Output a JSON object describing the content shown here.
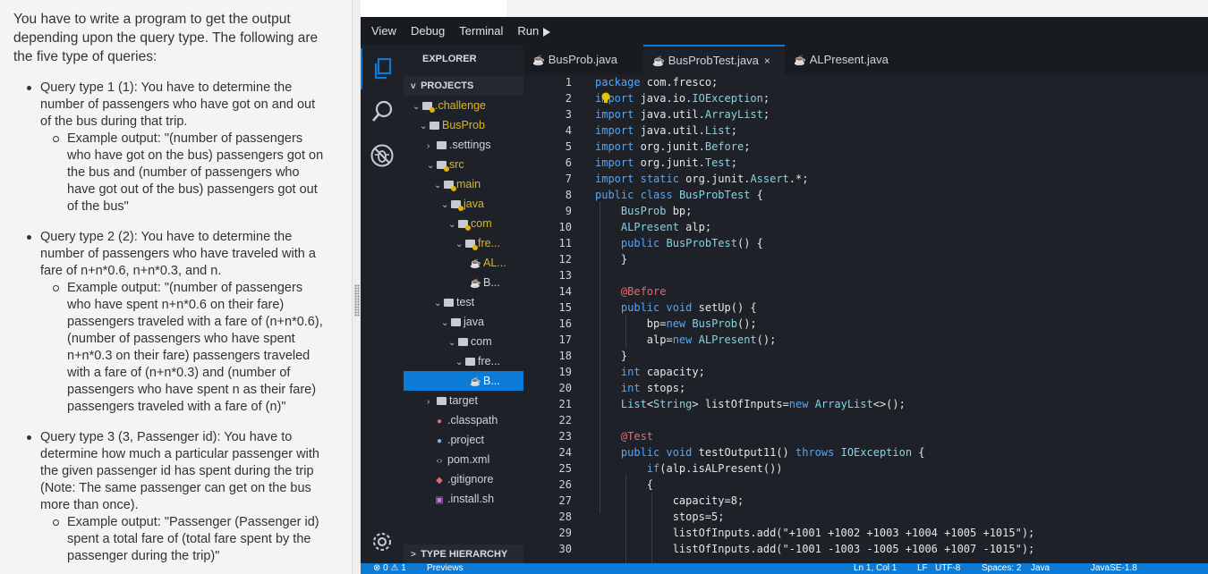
{
  "problem": {
    "intro": "You have to write a program to get the output depending upon the query type. The following are the five type of queries:",
    "queries": [
      {
        "text": "Query type 1 (1): You have to determine the number of passengers who have got on and out of the bus during that trip.",
        "example": "Example output: \"(number of passengers who have got on the bus) passengers got on the bus and (number of passengers who have got out of the bus) passengers got out of the bus\""
      },
      {
        "text": "Query type 2 (2): You have to determine the number of passengers who have traveled with a fare of n+n*0.6, n+n*0.3, and n.",
        "example": "Example output: \"(number of passengers who have spent n+n*0.6 on their fare) passengers traveled with a fare of (n+n*0.6), (number of passengers who have spent n+n*0.3 on their fare) passengers traveled with a fare of (n+n*0.3) and (number of passengers who have spent n as their fare) passengers traveled with a fare of (n)\""
      },
      {
        "text": "Query type 3 (3, Passenger id): You have to determine how much a particular passenger with the given passenger id has spent during the trip (Note: The same passenger can get on the bus more than once).",
        "example": "Example output: \"Passenger (Passenger id) spent a total fare of (total fare spent by the passenger during the trip)\""
      }
    ]
  },
  "menu": {
    "view": "View",
    "debug": "Debug",
    "terminal": "Terminal",
    "run": "Run"
  },
  "explorer": {
    "title": "EXPLORER",
    "projects": "PROJECTS",
    "type_hierarchy": "TYPE HIERARCHY",
    "tree": [
      {
        "label": ".challenge",
        "indent": 0,
        "chev": "v",
        "kind": "folder",
        "color": "yellow",
        "dot": true
      },
      {
        "label": "BusProb",
        "indent": 1,
        "chev": "v",
        "kind": "folder",
        "color": "yellow",
        "dot": false
      },
      {
        "label": ".settings",
        "indent": 2,
        "chev": ">",
        "kind": "folder",
        "color": "",
        "dot": false
      },
      {
        "label": "src",
        "indent": 2,
        "chev": "v",
        "kind": "folder",
        "color": "yellow",
        "dot": true
      },
      {
        "label": "main",
        "indent": 3,
        "chev": "v",
        "kind": "folder",
        "color": "yellow",
        "dot": true
      },
      {
        "label": "java",
        "indent": 4,
        "chev": "v",
        "kind": "folder",
        "color": "yellow",
        "dot": true
      },
      {
        "label": "com",
        "indent": 5,
        "chev": "v",
        "kind": "folder",
        "color": "yellow",
        "dot": true
      },
      {
        "label": "fre...",
        "indent": 6,
        "chev": "v",
        "kind": "folder",
        "color": "yellow",
        "dot": true
      },
      {
        "label": "AL...",
        "indent": 7,
        "chev": "",
        "kind": "java",
        "color": "yellow",
        "dot": true
      },
      {
        "label": "B...",
        "indent": 7,
        "chev": "",
        "kind": "java",
        "color": "",
        "dot": false
      },
      {
        "label": "test",
        "indent": 3,
        "chev": "v",
        "kind": "folder",
        "color": "",
        "dot": false
      },
      {
        "label": "java",
        "indent": 4,
        "chev": "v",
        "kind": "folder",
        "color": "",
        "dot": false
      },
      {
        "label": "com",
        "indent": 5,
        "chev": "v",
        "kind": "folder",
        "color": "",
        "dot": false
      },
      {
        "label": "fre...",
        "indent": 6,
        "chev": "v",
        "kind": "folder",
        "color": "",
        "dot": false
      },
      {
        "label": "B...",
        "indent": 7,
        "chev": "",
        "kind": "java",
        "color": "",
        "dot": false,
        "selected": true
      },
      {
        "label": "target",
        "indent": 2,
        "chev": ">",
        "kind": "folder",
        "color": "",
        "dot": false
      },
      {
        "label": ".classpath",
        "indent": 2,
        "chev": "",
        "kind": "classpath",
        "color": "",
        "dot": false
      },
      {
        "label": ".project",
        "indent": 2,
        "chev": "",
        "kind": "project",
        "color": "",
        "dot": false
      },
      {
        "label": "pom.xml",
        "indent": 2,
        "chev": "",
        "kind": "xml",
        "color": "",
        "dot": false
      },
      {
        "label": ".gitignore",
        "indent": 2,
        "chev": "",
        "kind": "git",
        "color": "",
        "dot": false
      },
      {
        "label": ".install.sh",
        "indent": 2,
        "chev": "",
        "kind": "sh",
        "color": "",
        "dot": false
      }
    ]
  },
  "tabs": [
    {
      "label": "BusProb.java",
      "active": false,
      "close": ""
    },
    {
      "label": "BusProbTest.java",
      "active": true,
      "close": "×"
    },
    {
      "label": "ALPresent.java",
      "active": false,
      "close": ""
    }
  ],
  "code": {
    "lines": [
      "package com.fresco;",
      "import java.io.IOException;",
      "import java.util.ArrayList;",
      "import java.util.List;",
      "import org.junit.Before;",
      "import org.junit.Test;",
      "import static org.junit.Assert.*;",
      "public class BusProbTest {",
      "    BusProb bp;",
      "    ALPresent alp;",
      "    public BusProbTest() {",
      "    }",
      "",
      "    @Before",
      "    public void setUp() {",
      "        bp=new BusProb();",
      "        alp=new ALPresent();",
      "    }",
      "    int capacity;",
      "    int stops;",
      "    List<String> listOfInputs=new ArrayList<>();",
      "",
      "    @Test",
      "    public void testOutput11() throws IOException {",
      "        if(alp.isALPresent())",
      "        {",
      "            capacity=8;",
      "            stops=5;",
      "            listOfInputs.add(\"+1001 +1002 +1003 +1004 +1005 +1015\");",
      "            listOfInputs.add(\"-1001 -1003 -1005 +1006 +1007 -1015\");"
    ]
  },
  "status": {
    "problems": "⊗ 0 ⚠ 1",
    "previews": "Previews",
    "position": "Ln 1, Col 1",
    "eol": "LF",
    "encoding": "UTF-8",
    "spaces": "Spaces: 2",
    "language": "Java",
    "jdk": "JavaSE-1.8"
  },
  "colors": {
    "accent": "#0c7bd6",
    "editor_bg": "#1e2127",
    "keyword": "#4fa7ff",
    "type": "#7fd6e6",
    "annotation": "#e06c75",
    "folder_highlight": "#e2b714"
  },
  "icons": [
    "files-icon",
    "search-icon",
    "no-bug-icon",
    "settings-gear-icon",
    "java-file-icon",
    "folder-icon",
    "chevron-icon",
    "run-arrow-icon"
  ]
}
